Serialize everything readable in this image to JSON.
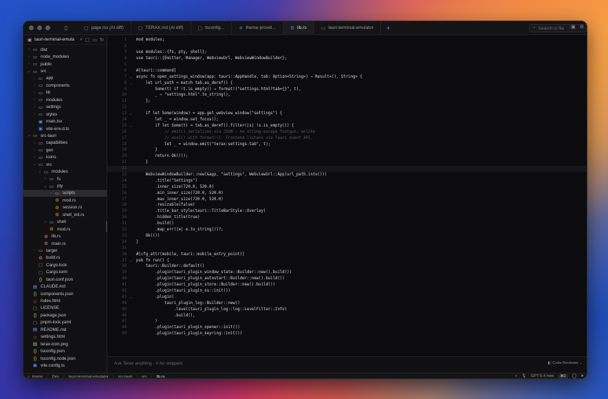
{
  "window": {
    "tabs": [
      {
        "label": "page.tsx (AI diff)",
        "icon": "file-icon",
        "active": false
      },
      {
        "label": "TERAX.md (AI diff)",
        "icon": "file-icon",
        "active": false
      },
      {
        "label": "tsconfig...",
        "icon": "file-icon",
        "active": false
      },
      {
        "label": "theme-provid...",
        "icon": "react-icon",
        "active": false
      },
      {
        "label": "lib.rs",
        "icon": "rust-icon",
        "active": true
      },
      {
        "label": "tauri-terminal-emulator",
        "icon": "folder-icon",
        "active": false
      }
    ],
    "search_placeholder": "Search in file"
  },
  "sidebar": {
    "title": "tauri-terminal-emula",
    "tree": [
      {
        "d": 0,
        "c": "›",
        "i": "folder",
        "t": "dist"
      },
      {
        "d": 0,
        "c": "›",
        "i": "folder",
        "t": "node_modules"
      },
      {
        "d": 0,
        "c": "›",
        "i": "folder",
        "t": "public"
      },
      {
        "d": 0,
        "c": "⌄",
        "i": "folder",
        "t": "src"
      },
      {
        "d": 1,
        "c": "›",
        "i": "folder",
        "t": "app"
      },
      {
        "d": 1,
        "c": "›",
        "i": "folder",
        "t": "components"
      },
      {
        "d": 1,
        "c": "›",
        "i": "folder",
        "t": "lib"
      },
      {
        "d": 1,
        "c": "›",
        "i": "folder",
        "t": "modules"
      },
      {
        "d": 1,
        "c": "›",
        "i": "folder",
        "t": "settings"
      },
      {
        "d": 1,
        "c": "›",
        "i": "folder",
        "t": "styles"
      },
      {
        "d": 1,
        "c": "",
        "i": "ts",
        "t": "main.tsx"
      },
      {
        "d": 1,
        "c": "",
        "i": "ts",
        "t": "vite-env.d.ts"
      },
      {
        "d": 0,
        "c": "⌄",
        "i": "folder",
        "t": "src-tauri"
      },
      {
        "d": 1,
        "c": "›",
        "i": "folder",
        "t": "capabilities"
      },
      {
        "d": 1,
        "c": "›",
        "i": "folder",
        "t": "gen"
      },
      {
        "d": 1,
        "c": "›",
        "i": "folder",
        "t": "icons"
      },
      {
        "d": 1,
        "c": "⌄",
        "i": "folder",
        "t": "src"
      },
      {
        "d": 2,
        "c": "⌄",
        "i": "folder",
        "t": "modules"
      },
      {
        "d": 3,
        "c": "›",
        "i": "folder",
        "t": "fs"
      },
      {
        "d": 3,
        "c": "⌄",
        "i": "folder",
        "t": "pty"
      },
      {
        "d": 4,
        "c": "›",
        "i": "folder",
        "t": "scripts",
        "sel": true
      },
      {
        "d": 4,
        "c": "",
        "i": "rs",
        "t": "mod.rs"
      },
      {
        "d": 4,
        "c": "",
        "i": "rs",
        "t": "session.rs"
      },
      {
        "d": 4,
        "c": "",
        "i": "rs",
        "t": "shell_init.rs"
      },
      {
        "d": 3,
        "c": "›",
        "i": "folder",
        "t": "shell"
      },
      {
        "d": 3,
        "c": "",
        "i": "rs",
        "t": "mod.rs"
      },
      {
        "d": 2,
        "c": "",
        "i": "rs",
        "t": "lib.rs"
      },
      {
        "d": 2,
        "c": "",
        "i": "rs",
        "t": "main.rs"
      },
      {
        "d": 1,
        "c": "›",
        "i": "folder",
        "t": "target"
      },
      {
        "d": 1,
        "c": "",
        "i": "rs",
        "t": "build.rs"
      },
      {
        "d": 1,
        "c": "",
        "i": "file",
        "t": "Cargo.lock"
      },
      {
        "d": 1,
        "c": "",
        "i": "file",
        "t": "Cargo.toml"
      },
      {
        "d": 1,
        "c": "",
        "i": "json",
        "t": "tauri.conf.json"
      },
      {
        "d": 0,
        "c": "",
        "i": "md",
        "t": "CLAUDE.md"
      },
      {
        "d": 0,
        "c": "",
        "i": "json",
        "t": "components.json"
      },
      {
        "d": 0,
        "c": "",
        "i": "html",
        "t": "index.html"
      },
      {
        "d": 0,
        "c": "",
        "i": "file",
        "t": "LICENSE"
      },
      {
        "d": 0,
        "c": "",
        "i": "json",
        "t": "package.json"
      },
      {
        "d": 0,
        "c": "",
        "i": "file",
        "t": "pnpm-lock.yaml"
      },
      {
        "d": 0,
        "c": "",
        "i": "md",
        "t": "README.md"
      },
      {
        "d": 0,
        "c": "",
        "i": "html",
        "t": "settings.html"
      },
      {
        "d": 0,
        "c": "",
        "i": "img",
        "t": "terax-icon.png"
      },
      {
        "d": 0,
        "c": "",
        "i": "json",
        "t": "tsconfig.json"
      },
      {
        "d": 0,
        "c": "",
        "i": "json",
        "t": "tsconfig.node.json"
      },
      {
        "d": 0,
        "c": "",
        "i": "ts",
        "t": "vite.config.ts"
      }
    ]
  },
  "editor": {
    "lines": [
      {
        "n": "1",
        "t": "mod modules;"
      },
      {
        "n": "2",
        "t": ""
      },
      {
        "n": "3",
        "t": "use modules::{fs, pty, shell};"
      },
      {
        "n": "4",
        "t": "use tauri::{Emitter, Manager, WebviewUrl, WebviewWindowBuilder};"
      },
      {
        "n": "5",
        "t": ""
      },
      {
        "n": "6",
        "t": "#[tauri::command]"
      },
      {
        "n": "7",
        "t": "async fn open_settings_window(app: tauri::AppHandle, tab: Option<String>) → Result<(), String> {",
        "fold": true
      },
      {
        "n": "8",
        "t": "    let url_path = match tab.as_deref() {",
        "fold": true
      },
      {
        "n": "9",
        "t": "        Some(t) if !t.is_empty() ⇒ format!(\"settings.html?tab={}\", t),"
      },
      {
        "n": "10",
        "t": "        _ ⇒ \"settings.html\".to_string(),"
      },
      {
        "n": "11",
        "t": "    };"
      },
      {
        "n": "12",
        "t": ""
      },
      {
        "n": "13",
        "t": "    if let Some(window) = app.get_webview_window(\"settings\") {",
        "fold": true
      },
      {
        "n": "14",
        "t": "        let _ = window.set_focus();"
      },
      {
        "n": "15",
        "t": "        if let Some(t) = tab.as_deref().filter(|s| !s.is_empty()) {",
        "fold": true
      },
      {
        "n": "16",
        "t": "            // emit() serializes via JSON — no string-escape footgun, unlike",
        "c": true
      },
      {
        "n": "17",
        "t": "            // eval() with format!(). Frontend listens via Tauri event API.",
        "c": true
      },
      {
        "n": "18",
        "t": "            let _ = window.emit(\"terax:settings-tab\", t);"
      },
      {
        "n": "19",
        "t": "        }"
      },
      {
        "n": "20",
        "t": "        return Ok(());"
      },
      {
        "n": "21",
        "t": "    }"
      },
      {
        "n": "22",
        "t": "",
        "hl": true
      },
      {
        "n": "23",
        "t": "    WebviewWindowBuilder::new(&app, \"settings\", WebviewUrl::App(url_path.into()))"
      },
      {
        "n": "24",
        "t": "        .title(\"Settings\")"
      },
      {
        "n": "25",
        "t": "        .inner_size(720.0, 520.0)"
      },
      {
        "n": "26",
        "t": "        .min_inner_size(720.0, 520.0)"
      },
      {
        "n": "27",
        "t": "        .max_inner_size(720.0, 520.0)"
      },
      {
        "n": "28",
        "t": "        .resizable(false)"
      },
      {
        "n": "29",
        "t": "        .title_bar_style(tauri::TitleBarStyle::Overlay)"
      },
      {
        "n": "30",
        "t": "        .hidden_title(true)"
      },
      {
        "n": "31",
        "t": "        .build()"
      },
      {
        "n": "32",
        "t": "        .map_err(|e| e.to_string())?;"
      },
      {
        "n": "33",
        "t": "    Ok(())"
      },
      {
        "n": "34",
        "t": "}"
      },
      {
        "n": "35",
        "t": ""
      },
      {
        "n": "36",
        "t": "#[cfg_attr(mobile, tauri::mobile_entry_point)]"
      },
      {
        "n": "37",
        "t": "pub fn run() {",
        "fold": true
      },
      {
        "n": "38",
        "t": "    tauri::Builder::default()"
      },
      {
        "n": "39",
        "t": "        .plugin(tauri_plugin_window_state::Builder::new().build())"
      },
      {
        "n": "40",
        "t": "        .plugin(tauri_plugin_autostart::Builder::new().build())"
      },
      {
        "n": "41",
        "t": "        .plugin(tauri_plugin_store::Builder::new().build())"
      },
      {
        "n": "42",
        "t": "        .plugin(tauri_plugin_os::init())"
      },
      {
        "n": "43",
        "t": "        .plugin(",
        "fold": true
      },
      {
        "n": "44",
        "t": "            tauri_plugin_log::Builder::new()"
      },
      {
        "n": "45",
        "t": "                .level(tauri_plugin_log::log::LevelFilter::Info)"
      },
      {
        "n": "46",
        "t": "                .build(),"
      },
      {
        "n": "47",
        "t": "        )"
      },
      {
        "n": "48",
        "t": "        .plugin(tauri_plugin_opener::init())"
      },
      {
        "n": "49",
        "t": "        .plugin(tauri_plugin_keyring::init())"
      }
    ]
  },
  "askbar": {
    "placeholder": "Ask Terax anything  ·  # for snippets",
    "reviewer": "Code Reviewer"
  },
  "statusbar": {
    "breadcrumb": [
      "Home",
      "Dev",
      "tauri-terminal-emulator",
      "src-tauri",
      "src",
      "lib.rs"
    ],
    "model": "GPT-5.4 mini",
    "badge": "⌘2"
  }
}
